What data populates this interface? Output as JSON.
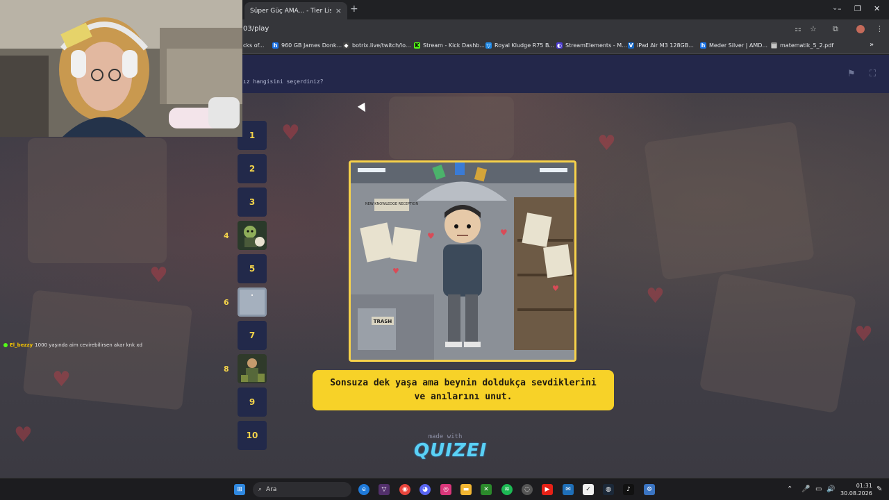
{
  "browser": {
    "tab_title": "Süper Güç AMA... - Tier List, Kü",
    "tab_close": "×",
    "new_tab": "+",
    "url": "03/play",
    "window_controls": [
      "–",
      "❐",
      "✕"
    ],
    "tab_search": "⌄",
    "bookmarks": [
      {
        "label": "cks of...",
        "icon": "",
        "color": "#35363a"
      },
      {
        "label": "960 GB James Donk...",
        "icon": "h",
        "color": "#1a73e8"
      },
      {
        "label": "botrix.live/twitch/lo...",
        "icon": "◆",
        "color": "#444"
      },
      {
        "label": "Stream - Kick Dashb...",
        "icon": "K",
        "color": "#53fc18"
      },
      {
        "label": "Royal Kludge R75 B...",
        "icon": "▽",
        "color": "#1e88e5"
      },
      {
        "label": "StreamElements - M...",
        "icon": "◐",
        "color": "#4b3bd1"
      },
      {
        "label": "iPad Air M3 128GB...",
        "icon": "V",
        "color": "#1565c0"
      },
      {
        "label": "Meder Silver | AMD...",
        "icon": "h",
        "color": "#1a73e8"
      },
      {
        "label": "matematik_5_2.pdf",
        "icon": "▤",
        "color": "#888"
      }
    ],
    "bookmarks_more": "»"
  },
  "quiz": {
    "question": "ız hangisini seçerdiniz?",
    "flag_icon": "⚑",
    "fullscreen_icon": "⛶",
    "ranks": [
      {
        "num": "1",
        "label": "",
        "thumb": false
      },
      {
        "num": "2",
        "label": "",
        "thumb": false
      },
      {
        "num": "3",
        "label": "",
        "thumb": false
      },
      {
        "num": "",
        "label": "4",
        "thumb": true
      },
      {
        "num": "5",
        "label": "",
        "thumb": false
      },
      {
        "num": "",
        "label": "6",
        "thumb": true
      },
      {
        "num": "7",
        "label": "",
        "thumb": false
      },
      {
        "num": "",
        "label": "8",
        "thumb": true
      },
      {
        "num": "9",
        "label": "",
        "thumb": false
      },
      {
        "num": "10",
        "label": "",
        "thumb": false
      }
    ],
    "card_labels": {
      "reception_sign": "NEW KNOWLEDGE RECEPTION",
      "trash": "TRASH"
    },
    "answer": "Sonsuza dek yaşa ama beynin doldukça sevdiklerini ve anılarını unut.",
    "made_with": "made with",
    "brand": "QUIZEI"
  },
  "chat": {
    "user": "El_bezzy",
    "message": "1000 yaşında aim cevirebilirsen akar knk xd"
  },
  "taskbar": {
    "search_placeholder": "Ara",
    "time": "01:31",
    "date": "30.08.2026",
    "tray": [
      "⌃",
      "🎤",
      "▭",
      "🔊",
      "✎"
    ]
  }
}
